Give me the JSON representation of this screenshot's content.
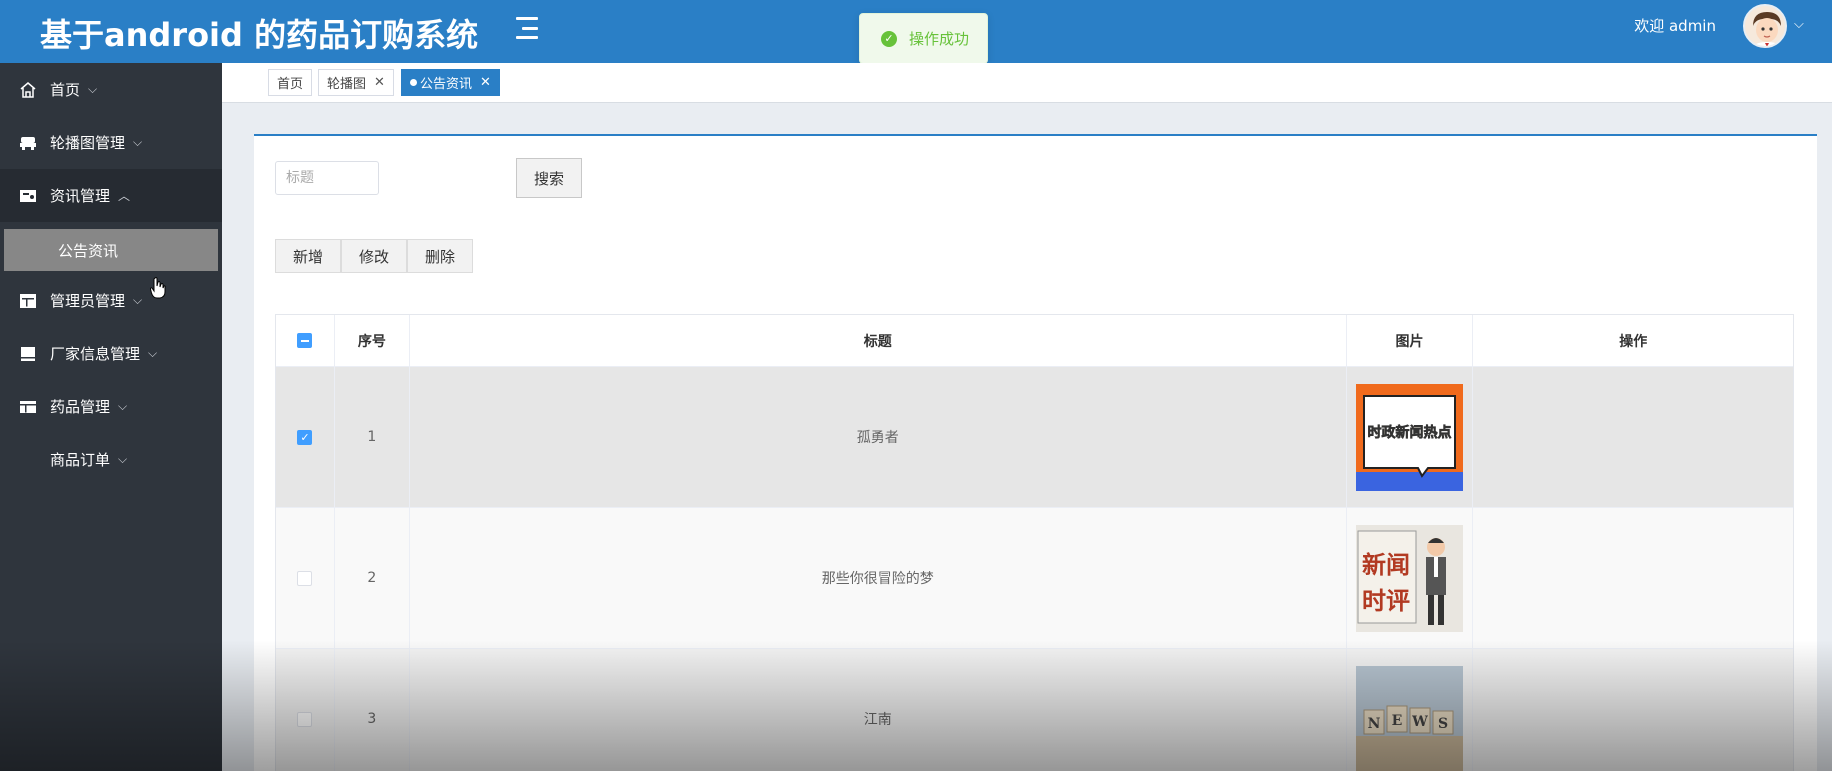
{
  "header": {
    "title": "基于android 的药品订购系统",
    "welcome": "欢迎 admin",
    "toast": "操作成功",
    "accent_color": "#2a7fc6"
  },
  "sidebar": {
    "items": [
      {
        "label": "首页",
        "icon": "home-icon"
      },
      {
        "label": "轮播图管理",
        "icon": "carousel-icon"
      },
      {
        "label": "资讯管理",
        "icon": "news-icon"
      },
      {
        "label": "管理员管理",
        "icon": "admin-icon"
      },
      {
        "label": "厂家信息管理",
        "icon": "factory-icon"
      },
      {
        "label": "药品管理",
        "icon": "medicine-icon"
      },
      {
        "label": "商品订单",
        "icon": ""
      }
    ],
    "sub_item": "公告资讯"
  },
  "tabs": [
    {
      "label": "首页"
    },
    {
      "label": "轮播图"
    },
    {
      "label": "公告资讯"
    }
  ],
  "search": {
    "placeholder": "标题",
    "button": "搜索"
  },
  "actions": {
    "add": "新增",
    "edit": "修改",
    "delete": "删除"
  },
  "table": {
    "headers": {
      "no": "序号",
      "title": "标题",
      "image": "图片",
      "op": "操作"
    },
    "rows": [
      {
        "no": "1",
        "title": "孤勇者",
        "image": "news-hot-thumbnail",
        "image_text": "时政新闻热点",
        "checked": true
      },
      {
        "no": "2",
        "title": "那些你很冒险的梦",
        "image": "news-comment-thumbnail",
        "image_text": "新闻时评",
        "checked": false
      },
      {
        "no": "3",
        "title": "江南",
        "image": "news-blocks-thumbnail",
        "image_text": "NEWS",
        "checked": false
      }
    ]
  }
}
